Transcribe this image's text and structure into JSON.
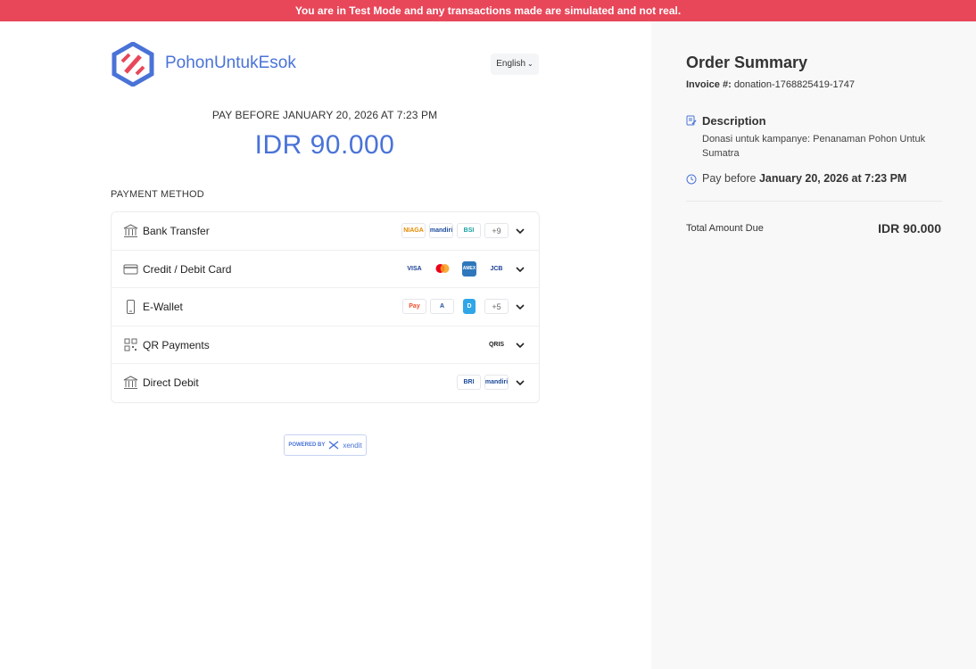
{
  "banner": {
    "text": "You are in Test Mode and any transactions made are simulated and not real."
  },
  "brand": {
    "name": "PohonUntukEsok"
  },
  "language": {
    "selected": "English"
  },
  "payment": {
    "pay_before": "PAY BEFORE JANUARY 20, 2026 AT 7:23 PM",
    "amount": "IDR 90.000",
    "method_label": "PAYMENT METHOD"
  },
  "methods": [
    {
      "label": "Bank Transfer",
      "icon": "bank-icon",
      "chips": [
        "NIAGA",
        "mandiri",
        "BSI",
        "+9"
      ]
    },
    {
      "label": "Credit / Debit Card",
      "icon": "card-icon",
      "chips": [
        "VISA",
        "MC",
        "AMEX",
        "JCB"
      ]
    },
    {
      "label": "E-Wallet",
      "icon": "phone-icon",
      "chips": [
        "Pay",
        "A",
        "D",
        "+5"
      ]
    },
    {
      "label": "QR Payments",
      "icon": "qr-icon",
      "chips": [
        "QRIS"
      ]
    },
    {
      "label": "Direct Debit",
      "icon": "bank-icon",
      "chips": [
        "BRI",
        "mandiri"
      ]
    }
  ],
  "powered": {
    "prefix": "POWERED BY",
    "name": "xendit"
  },
  "summary": {
    "title": "Order Summary",
    "invoice_label": "Invoice #:",
    "invoice_value": "donation-1768825419-1747",
    "description_title": "Description",
    "description_text": "Donasi untuk kampanye: Penanaman Pohon Untuk Sumatra",
    "pay_before_label": "Pay before",
    "pay_before_value": "January 20, 2026 at 7:23 PM",
    "total_label": "Total Amount Due",
    "total_value": "IDR 90.000"
  },
  "colors": {
    "banner": "#e8475a",
    "accent": "#4a73d8",
    "logo_red": "#e8475a"
  }
}
